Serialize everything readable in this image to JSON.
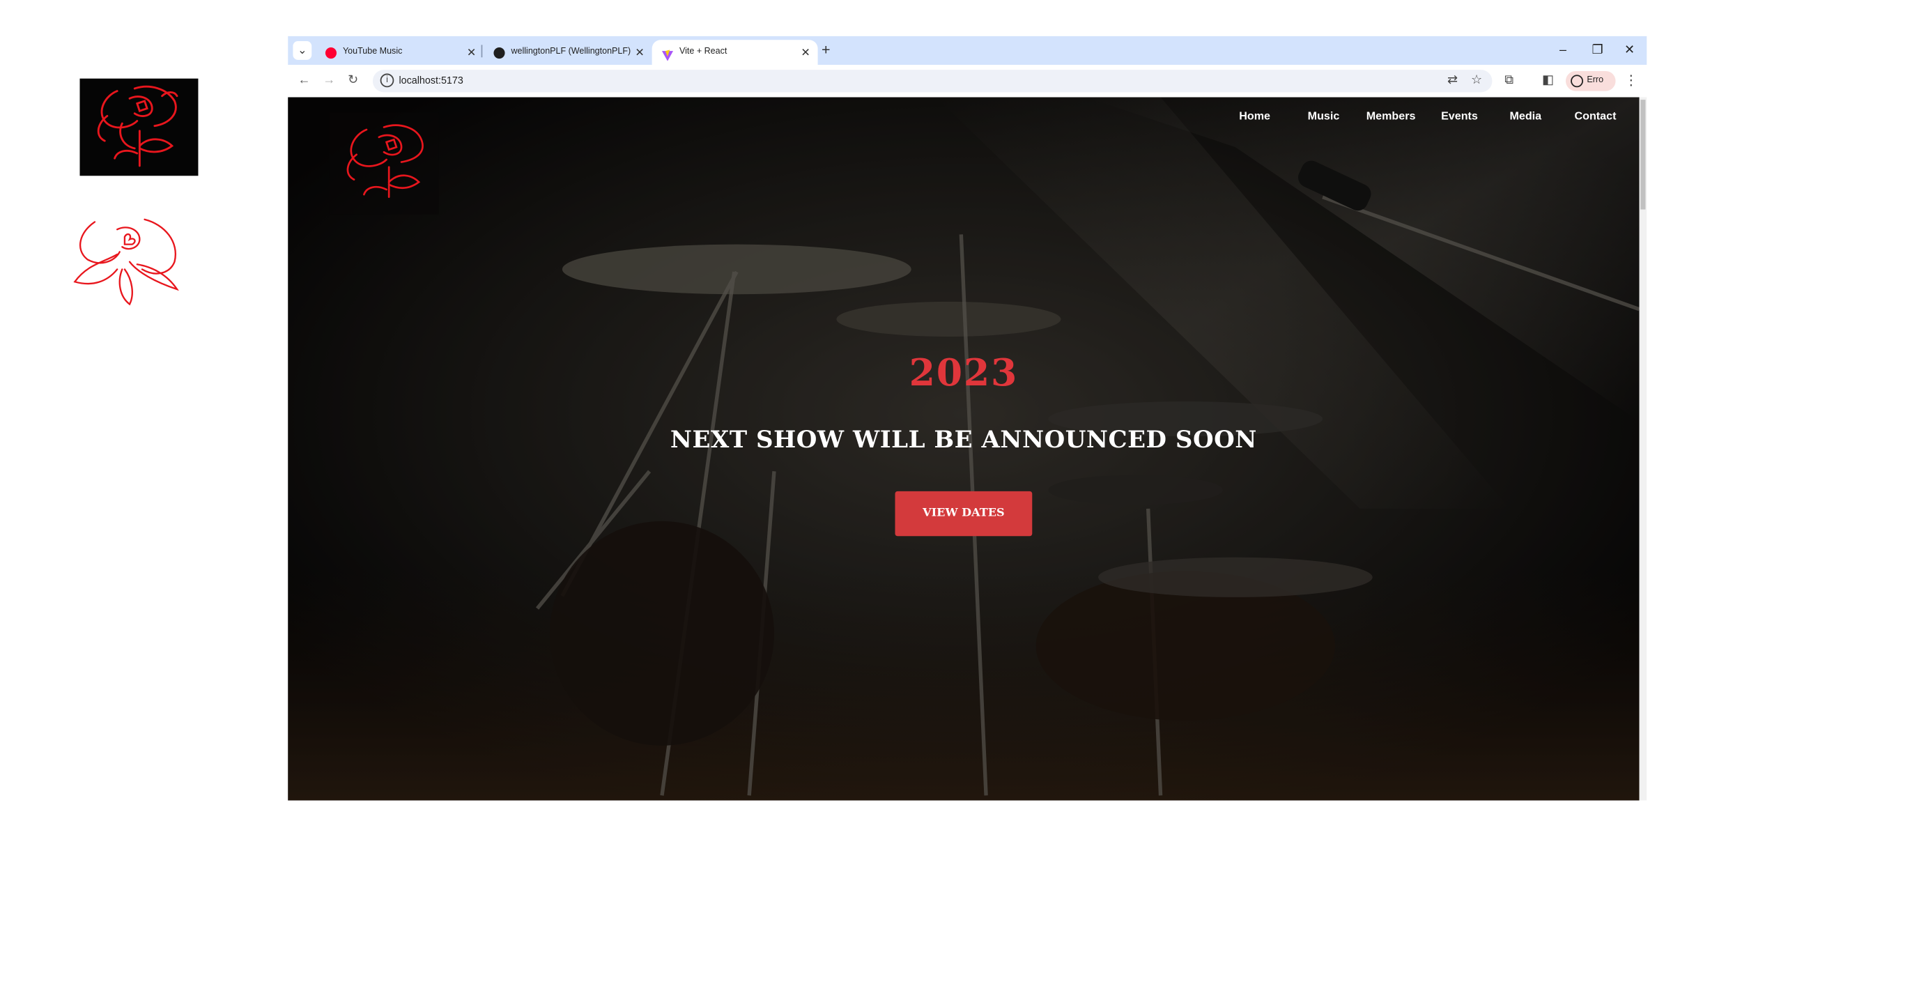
{
  "browser": {
    "tabs": [
      {
        "label": "YouTube Music",
        "icon": "youtube-music-icon",
        "active": false
      },
      {
        "label": "wellingtonPLF (WellingtonPLF)",
        "icon": "github-icon",
        "active": false
      },
      {
        "label": "Vite + React",
        "icon": "vite-icon",
        "active": true
      }
    ],
    "url": "localhost:5173",
    "profile_label": "Erro"
  },
  "site": {
    "nav": [
      "Home",
      "Music",
      "Members",
      "Events",
      "Media",
      "Contact"
    ],
    "hero": {
      "year": "2023",
      "title": "NEXT SHOW WILL BE ANNOUNCED SOON",
      "button": "VIEW DATES"
    }
  },
  "colors": {
    "accent_red": "#e0363b",
    "button_red": "#d33a3c",
    "tabstrip": "#d3e3fd",
    "logo_red": "#e8161d"
  }
}
